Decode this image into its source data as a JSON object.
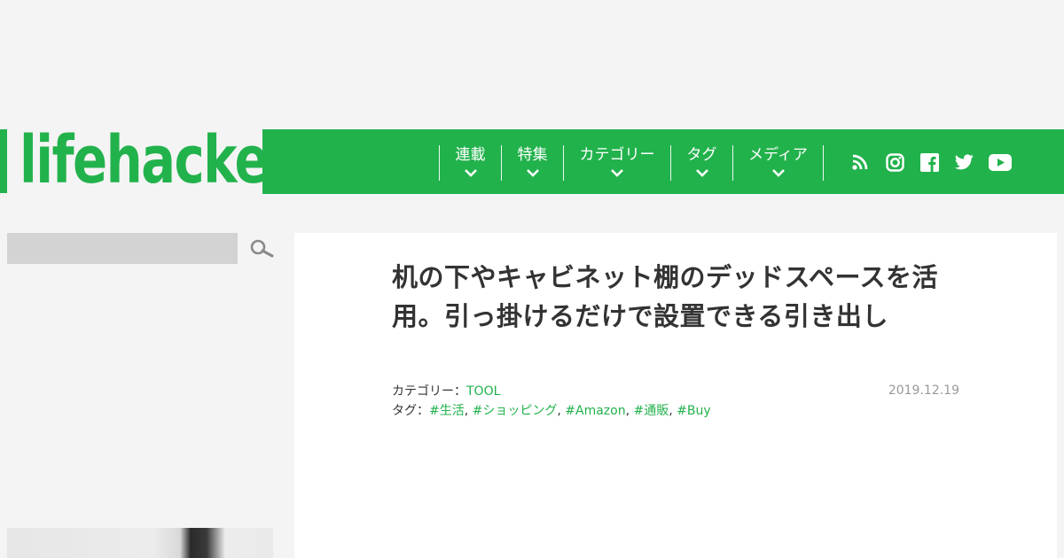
{
  "site": {
    "logo_text": "lifehacker"
  },
  "nav": {
    "items": [
      {
        "label": "連載"
      },
      {
        "label": "特集"
      },
      {
        "label": "カテゴリー"
      },
      {
        "label": "タグ"
      },
      {
        "label": "メディア"
      }
    ],
    "social": [
      "rss-icon",
      "instagram-icon",
      "facebook-icon",
      "twitter-icon",
      "youtube-icon"
    ]
  },
  "sidebar": {
    "search_placeholder": ""
  },
  "article": {
    "title": "机の下やキャビネット棚のデッドスペースを活用。引っ掛けるだけで設置できる引き出し",
    "category_label": "カテゴリー：",
    "category": "TOOL",
    "tags_label": "タグ：",
    "tags": [
      "#生活",
      "#ショッピング",
      "#Amazon",
      "#通販",
      "#Buy"
    ],
    "tag_sep": ", ",
    "date": "2019.12.19"
  },
  "colors": {
    "brand": "#22b24c",
    "background": "#f4f4f4"
  }
}
